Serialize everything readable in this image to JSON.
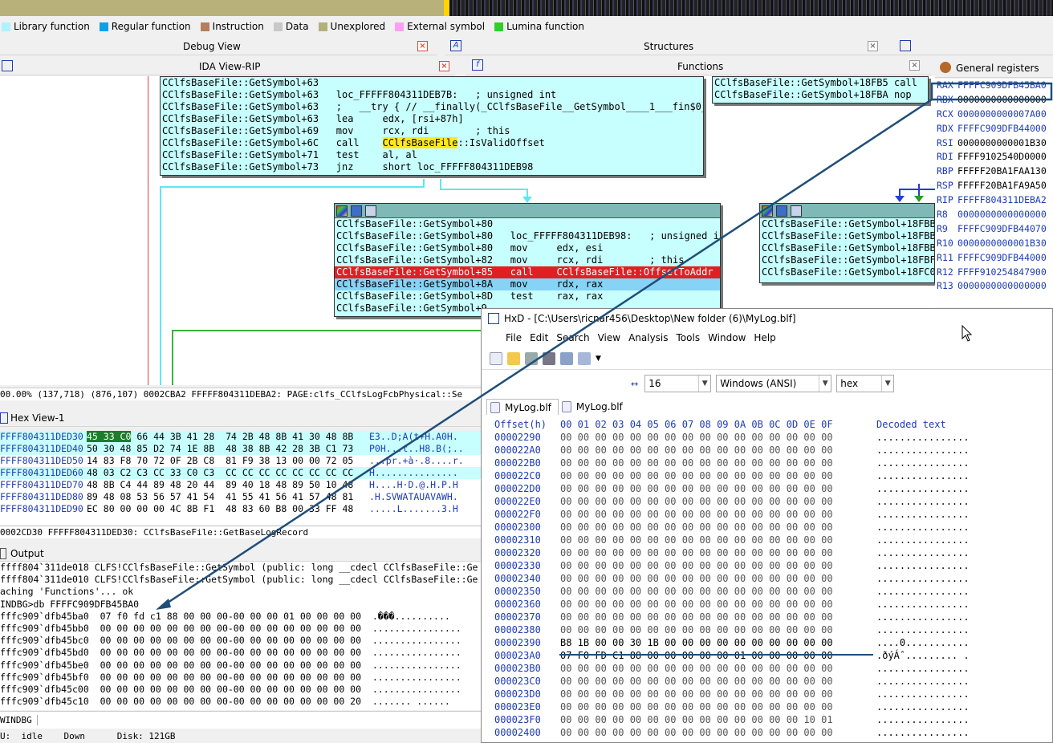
{
  "legend": [
    {
      "label": "Library function",
      "color": "#aef2ff"
    },
    {
      "label": "Regular function",
      "color": "#0aa1ea"
    },
    {
      "label": "Instruction",
      "color": "#b57e5f"
    },
    {
      "label": "Data",
      "color": "#c8c8c8"
    },
    {
      "label": "Unexplored",
      "color": "#b3b17a"
    },
    {
      "label": "External symbol",
      "color": "#ff9ff3"
    },
    {
      "label": "Lumina function",
      "color": "#2ad22a"
    }
  ],
  "panels": {
    "debug_view": "Debug View",
    "structures": "Structures",
    "ida_view": "IDA View-RIP",
    "functions": "Functions",
    "general_registers": "General registers",
    "hex_view": "Hex View-1",
    "output": "Output",
    "windbg_tab": "WINDBG"
  },
  "graph": {
    "block1": [
      "CClfsBaseFile::GetSymbol+63",
      "CClfsBaseFile::GetSymbol+63   loc_FFFFF804311DEB7B:   ; unsigned int",
      "CClfsBaseFile::GetSymbol+63   ;   __try { // __finally(_CClfsBaseFile__GetSymbol____1___fin$0_0)",
      "CClfsBaseFile::GetSymbol+63   lea     edx, [rsi+87h]",
      "CClfsBaseFile::GetSymbol+69   mov     rcx, rdi        ; this",
      "CClfsBaseFile::GetSymbol+6C   call    CClfsBaseFile::IsValidOffset",
      "CClfsBaseFile::GetSymbol+71   test    al, al",
      "CClfsBaseFile::GetSymbol+73   jnz     short loc_FFFFF804311DEB98"
    ],
    "block2": [
      "CClfsBaseFile::GetSymbol+80",
      "CClfsBaseFile::GetSymbol+80   loc_FFFFF804311DEB98:   ; unsigned int",
      "CClfsBaseFile::GetSymbol+80   mov     edx, esi",
      "CClfsBaseFile::GetSymbol+82   mov     rcx, rdi        ; this",
      "CClfsBaseFile::GetSymbol+85   call    CClfsBaseFile::OffsetToAddr",
      "CClfsBaseFile::GetSymbol+8A   mov     rdx, rax",
      "CClfsBaseFile::GetSymbol+8D   test    rax, rax",
      "CClfsBaseFile::GetSymbol+9"
    ],
    "block3": [
      "CClfsBaseFile::GetSymbol+18FB5 call",
      "CClfsBaseFile::GetSymbol+18FBA nop"
    ],
    "block4": [
      "CClfsBaseFile::GetSymbol+18FBB",
      "CClfsBaseFile::GetSymbol+18FBB",
      "CClfsBaseFile::GetSymbol+18FBB",
      "CClfsBaseFile::GetSymbol+18FBF",
      "CClfsBaseFile::GetSymbol+18FC0"
    ],
    "status": "00.00% (137,718) (876,107) 0002CBA2 FFFFF804311DEBA2: PAGE:clfs_CClfsLogFcbPhysical::Se"
  },
  "registers": [
    {
      "name": "RAX",
      "value": "FFFFC909DFB45BA0"
    },
    {
      "name": "RBX",
      "value": "0000000000000000"
    },
    {
      "name": "RCX",
      "value": "0000000000007A00"
    },
    {
      "name": "RDX",
      "value": "FFFFC909DFB44000"
    },
    {
      "name": "RSI",
      "value": "0000000000001B30"
    },
    {
      "name": "RDI",
      "value": "FFFF9102540D0000"
    },
    {
      "name": "RBP",
      "value": "FFFFF20BA1FAA130"
    },
    {
      "name": "RSP",
      "value": "FFFFF20BA1FA9A50"
    },
    {
      "name": "RIP",
      "value": "FFFFF804311DEBA2"
    },
    {
      "name": "R8",
      "value": "0000000000000000"
    },
    {
      "name": "R9",
      "value": "FFFFC909DFB44070"
    },
    {
      "name": "R10",
      "value": "0000000000001B30"
    },
    {
      "name": "R11",
      "value": "FFFFC909DFB44000"
    },
    {
      "name": "R12",
      "value": "FFFF910254847900"
    },
    {
      "name": "R13",
      "value": "0000000000000000"
    }
  ],
  "hexview": {
    "rows": [
      {
        "addr": "FFFF804311DED30",
        "hex": "45 33 C0 66 44 3B 41 28  74 2B 48 8B 41 30 48 8B",
        "text": "E3..D;A(t+H.A0H."
      },
      {
        "addr": "FFFF804311DED40",
        "hex": "50 30 48 85 D2 74 1E 8B  48 38 8B 42 28 3B C1 73",
        "text": "P0H...t..H8.B(;.."
      },
      {
        "addr": "FFFF804311DED50",
        "hex": "14 83 F8 70 72 0F 2B C8  81 F9 38 13 00 00 72 05",
        "text": "...pr.+à·.8....r."
      },
      {
        "addr": "FFFF804311DED60",
        "hex": "48 03 C2 C3 CC 33 C0 C3  CC CC CC CC CC CC CC CC",
        "text": "H..............."
      },
      {
        "addr": "FFFF804311DED70",
        "hex": "48 8B C4 44 89 48 20 44  89 40 18 48 89 50 10 48",
        "text": "H....H·D.@.H.P.H"
      },
      {
        "addr": "FFFF804311DED80",
        "hex": "89 48 08 53 56 57 41 54  41 55 41 56 41 57 48 81",
        "text": ".H.SVWATAUAVAWH."
      },
      {
        "addr": "FFFF804311DED90",
        "hex": "EC 80 00 00 00 4C 8B F1  48 83 60 B8 00 33 FF 48",
        "text": ".....L.......3.H"
      }
    ],
    "status": "0002CD30 FFFFF804311DED30: CClfsBaseFile::GetBaseLogRecord"
  },
  "output": {
    "lines": [
      "ffff804`311de018 CLFS!CClfsBaseFile::GetSymbol (public: long __cdecl CClfsBaseFile::Ge",
      "ffff804`311de010 CLFS!CClfsBaseFile::GetSymbol (public: long __cdecl CClfsBaseFile::Ge",
      "aching 'Functions'... ok",
      "INDBG>db FFFFC909DFB45BA0",
      "fffc909`dfb45ba0  07 f0 fd c1 88 00 00 00-00 00 00 01 00 00 00 00  .���..........",
      "fffc909`dfb45bb0  00 00 00 00 00 00 00 00-00 00 00 00 00 00 00 00  ................",
      "fffc909`dfb45bc0  00 00 00 00 00 00 00 00-00 00 00 00 00 00 00 00  ................",
      "fffc909`dfb45bd0  00 00 00 00 00 00 00 00-00 00 00 00 00 00 00 00  ................",
      "fffc909`dfb45be0  00 00 00 00 00 00 00 00-00 00 00 00 00 00 00 00  ................",
      "fffc909`dfb45bf0  00 00 00 00 00 00 00 00-00 00 00 00 00 00 00 00  ................",
      "fffc909`dfb45c00  00 00 00 00 00 00 00 00-00 00 00 00 00 00 00 00  ................",
      "fffc909`dfb45c10  00 00 00 00 00 00 00 00-00 00 00 00 00 00 00 20  ....... ......"
    ],
    "statusbar": "U:  idle    Down      Disk: 121GB"
  },
  "hxd": {
    "title": "HxD - [C:\\Users\\ricnar456\\Desktop\\New folder (6)\\MyLog.blf]",
    "menu": [
      "File",
      "Edit",
      "Search",
      "View",
      "Analysis",
      "Tools",
      "Window",
      "Help"
    ],
    "bytes_per_row": "16",
    "charset": "Windows (ANSI)",
    "mode": "hex",
    "tabs": [
      "MyLog.blf",
      "MyLog.blf"
    ],
    "header": {
      "offset": "Offset(h)",
      "cols": "00 01 02 03 04 05 06 07 08 09 0A 0B 0C 0D 0E 0F",
      "decoded": "Decoded text"
    },
    "rows": [
      {
        "o": "00002290",
        "h": "00 00 00 00 00 00 00 00 00 00 00 00 00 00 00 00",
        "t": "................"
      },
      {
        "o": "000022A0",
        "h": "00 00 00 00 00 00 00 00 00 00 00 00 00 00 00 00",
        "t": "................"
      },
      {
        "o": "000022B0",
        "h": "00 00 00 00 00 00 00 00 00 00 00 00 00 00 00 00",
        "t": "................"
      },
      {
        "o": "000022C0",
        "h": "00 00 00 00 00 00 00 00 00 00 00 00 00 00 00 00",
        "t": "................"
      },
      {
        "o": "000022D0",
        "h": "00 00 00 00 00 00 00 00 00 00 00 00 00 00 00 00",
        "t": "................"
      },
      {
        "o": "000022E0",
        "h": "00 00 00 00 00 00 00 00 00 00 00 00 00 00 00 00",
        "t": "................"
      },
      {
        "o": "000022F0",
        "h": "00 00 00 00 00 00 00 00 00 00 00 00 00 00 00 00",
        "t": "................"
      },
      {
        "o": "00002300",
        "h": "00 00 00 00 00 00 00 00 00 00 00 00 00 00 00 00",
        "t": "................"
      },
      {
        "o": "00002310",
        "h": "00 00 00 00 00 00 00 00 00 00 00 00 00 00 00 00",
        "t": "................"
      },
      {
        "o": "00002320",
        "h": "00 00 00 00 00 00 00 00 00 00 00 00 00 00 00 00",
        "t": "................"
      },
      {
        "o": "00002330",
        "h": "00 00 00 00 00 00 00 00 00 00 00 00 00 00 00 00",
        "t": "................"
      },
      {
        "o": "00002340",
        "h": "00 00 00 00 00 00 00 00 00 00 00 00 00 00 00 00",
        "t": "................"
      },
      {
        "o": "00002350",
        "h": "00 00 00 00 00 00 00 00 00 00 00 00 00 00 00 00",
        "t": "................"
      },
      {
        "o": "00002360",
        "h": "00 00 00 00 00 00 00 00 00 00 00 00 00 00 00 00",
        "t": "................"
      },
      {
        "o": "00002370",
        "h": "00 00 00 00 00 00 00 00 00 00 00 00 00 00 00 00",
        "t": "................"
      },
      {
        "o": "00002380",
        "h": "00 00 00 00 00 00 00 00 00 00 00 00 00 00 00 00",
        "t": "................"
      },
      {
        "o": "00002390",
        "h": "B8 1B 00 00 30 1B 00 00 00 00 00 00 00 00 00 00",
        "t": "....0..........."
      },
      {
        "o": "000023A0",
        "h": "07 F0 FD C1 88 00 00 00 00 00 01 00 00 00 00 00",
        "t": ".ðýÁˆ......... ."
      },
      {
        "o": "000023B0",
        "h": "00 00 00 00 00 00 00 00 00 00 00 00 00 00 00 00",
        "t": "................"
      },
      {
        "o": "000023C0",
        "h": "00 00 00 00 00 00 00 00 00 00 00 00 00 00 00 00",
        "t": "................"
      },
      {
        "o": "000023D0",
        "h": "00 00 00 00 00 00 00 00 00 00 00 00 00 00 00 00",
        "t": "................"
      },
      {
        "o": "000023E0",
        "h": "00 00 00 00 00 00 00 00 00 00 00 00 00 00 00 00",
        "t": "................"
      },
      {
        "o": "000023F0",
        "h": "00 00 00 00 00 00 00 00 00 00 00 00 00 00 10 01",
        "t": "................"
      },
      {
        "o": "00002400",
        "h": "00 00 00 00 00 00 00 00 00 00 00 00 00 00 00 00",
        "t": "................"
      }
    ]
  },
  "colors": {
    "accent_blue": "#1f4e79",
    "highlight_red": "#e02020",
    "graph_block": "#c7fffe"
  }
}
